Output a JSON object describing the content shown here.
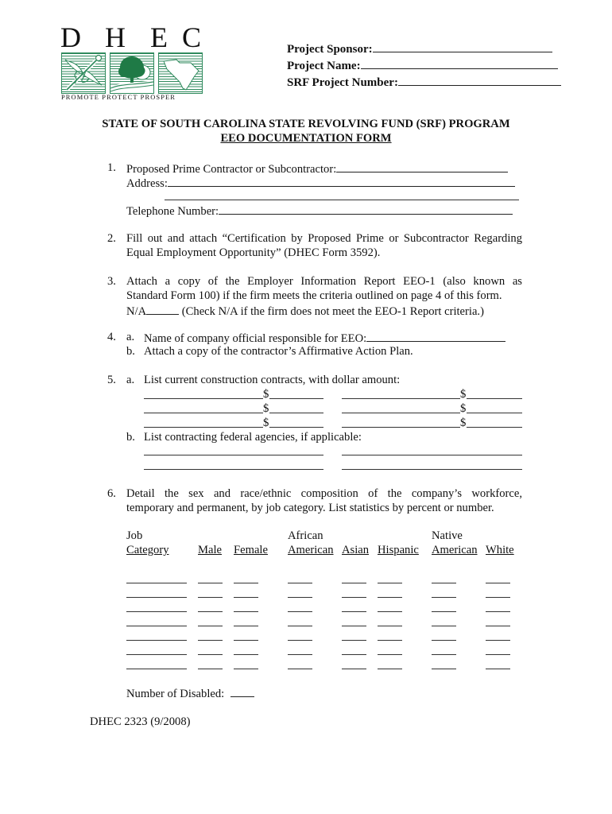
{
  "logo": {
    "letters": [
      "D",
      "H",
      "E",
      "C"
    ],
    "tagline": "PROMOTE PROTECT PROSPER",
    "panels": [
      "caduceus-icon",
      "tree-icon",
      "south-carolina-map-icon"
    ],
    "brand_color": "#2f8a5d"
  },
  "header_fields": {
    "sponsor_label": "Project Sponsor:",
    "name_label": "Project Name:",
    "srf_label": "SRF Project Number:"
  },
  "title": {
    "line1": "STATE OF SOUTH CAROLINA STATE REVOLVING FUND (SRF) PROGRAM",
    "line2": "EEO DOCUMENTATION FORM"
  },
  "items": {
    "item1": {
      "number": "1.",
      "contractor_label": "Proposed Prime Contractor or Subcontractor:",
      "address_label": "Address:",
      "telephone_label": "Telephone Number:"
    },
    "item2": {
      "number": "2.",
      "line1": "Fill out and attach “Certification by Proposed Prime or Subcontractor Regarding",
      "line2": "Equal Employment Opportunity” (DHEC Form 3592)."
    },
    "item3": {
      "number": "3.",
      "line1": "Attach a copy of the Employer Information Report EEO-1 (also known as",
      "line2": "Standard Form 100) if the firm meets the criteria outlined on page 4 of this form.",
      "na_label": "N/A",
      "na_note": "(Check N/A if the firm does not meet the EEO-1 Report criteria.)"
    },
    "item4": {
      "number": "4.",
      "a_marker": "a.",
      "a_text": "Name of company official responsible for EEO:",
      "b_marker": "b.",
      "b_text": "Attach a copy of the contractor’s Affirmative Action Plan."
    },
    "item5": {
      "number": "5.",
      "a_marker": "a.",
      "a_text": "List current construction contracts, with dollar amount:",
      "dollar_sign": "$",
      "b_marker": "b.",
      "b_text": "List contracting federal agencies, if applicable:"
    },
    "item6": {
      "number": "6.",
      "line1": "Detail the sex and race/ethnic composition of the company’s workforce,",
      "line2": "temporary and permanent, by job category.  List statistics by percent or number.",
      "columns": [
        {
          "top": "Job",
          "bottom": "Category"
        },
        {
          "top": "",
          "bottom": "Male"
        },
        {
          "top": "",
          "bottom": "Female"
        },
        {
          "top": "African",
          "bottom": "American"
        },
        {
          "top": "",
          "bottom": "Asian"
        },
        {
          "top": "",
          "bottom": "Hispanic"
        },
        {
          "top": "Native",
          "bottom": "American"
        },
        {
          "top": "",
          "bottom": "White"
        }
      ],
      "blank_rows": 7,
      "disabled_label": "Number of Disabled:"
    }
  },
  "footer": {
    "form_id": "DHEC 2323 (9/2008)"
  }
}
